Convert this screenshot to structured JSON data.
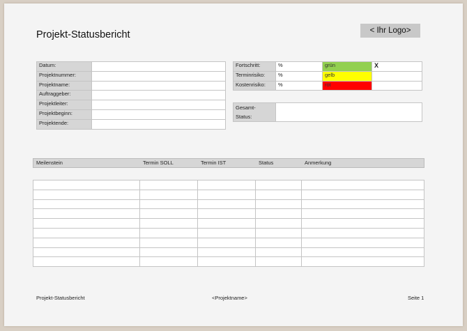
{
  "title": "Projekt-Statusbericht",
  "logo": "< Ihr Logo>",
  "project_info": [
    "Datum:",
    "Projektnummer:",
    "Projektname:",
    "Auftraggeber:",
    "Projektleiter:",
    "Projektbeginn:",
    "Projektende:"
  ],
  "status": [
    {
      "label": "Fortschritt:",
      "unit": "%",
      "color_label": "grün",
      "color": "#92d050",
      "mark": "X"
    },
    {
      "label": "Terminrisiko:",
      "unit": "%",
      "color_label": "gelb",
      "color": "#ffff00",
      "mark": ""
    },
    {
      "label": "Kostenrisiko:",
      "unit": "%",
      "color_label": "rot",
      "color": "#ff0000",
      "mark": ""
    }
  ],
  "gesamt": {
    "line1": "Gesamt-",
    "line2": "Status:"
  },
  "milestones": {
    "headers": [
      "Meilenstein",
      "Termin SOLL",
      "Termin IST",
      "Status",
      "Anmerkung"
    ],
    "row_count": 9
  },
  "footer": {
    "left": "Projekt-Statusbericht",
    "center": "<Projektname>",
    "right": "Seite 1"
  }
}
